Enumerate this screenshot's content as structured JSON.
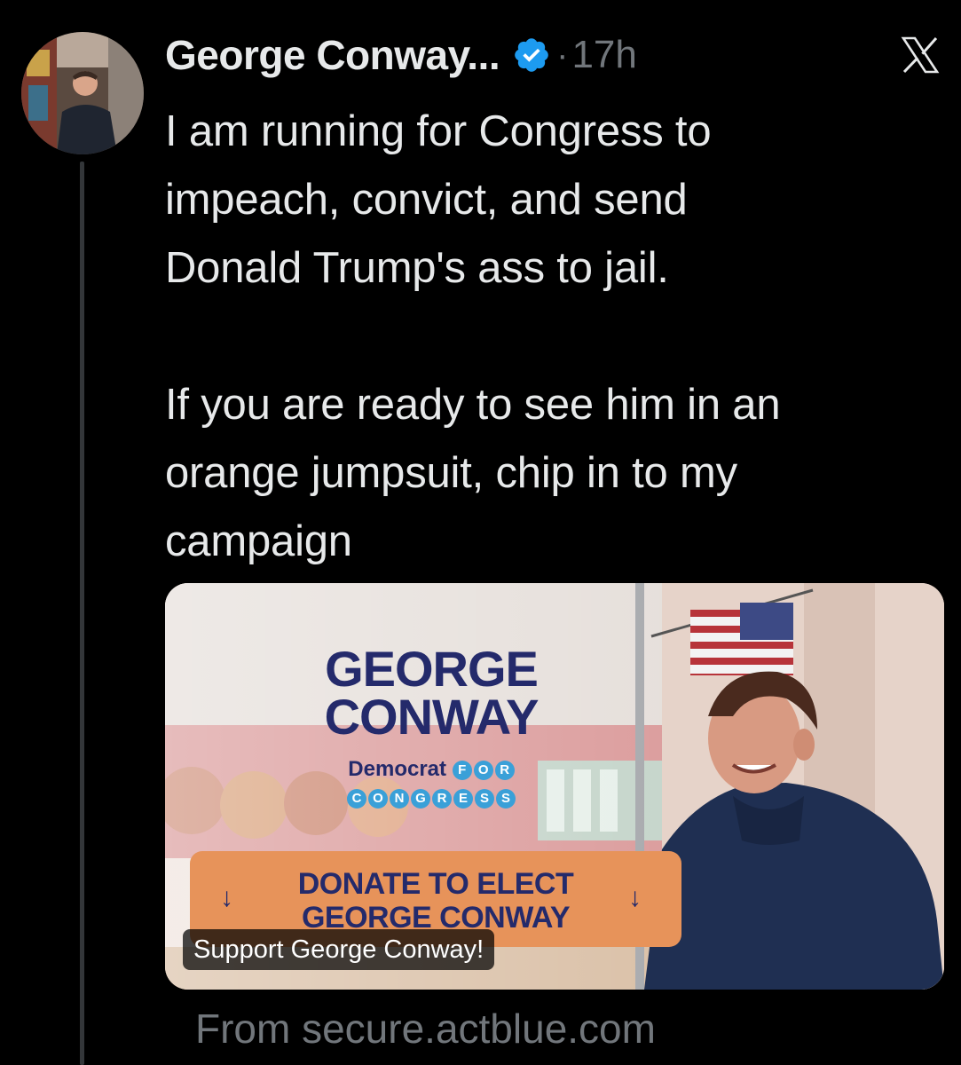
{
  "tweet": {
    "author": {
      "display_name": "George Conway...",
      "verified": true,
      "avatar_icon": "profile-photo"
    },
    "timestamp_separator": "·",
    "timestamp": "17h",
    "platform_icon": "x-logo-icon",
    "text_paragraphs": [
      "I am running for Congress to\nimpeach, convict, and send\nDonald Trump's ass to jail.",
      "If you are ready to see him in an\norange jumpsuit, chip in to my\ncampaign"
    ],
    "card": {
      "brand_line1": "GEORGE",
      "brand_line2": "CONWAY",
      "party": "Democrat",
      "for_letters": [
        "F",
        "O",
        "R"
      ],
      "congress_letters": [
        "C",
        "O",
        "N",
        "G",
        "R",
        "E",
        "S",
        "S"
      ],
      "donate_text": "DONATE TO ELECT\nGEORGE CONWAY",
      "title_overlay": "Support George Conway!",
      "domain": "From secure.actblue.com"
    }
  },
  "colors": {
    "background": "#000000",
    "text_primary": "#e7e9ea",
    "text_secondary": "#71767b",
    "verified_blue": "#1d9bf0",
    "brand_navy": "#242a6b",
    "donate_orange": "#e7935a"
  }
}
